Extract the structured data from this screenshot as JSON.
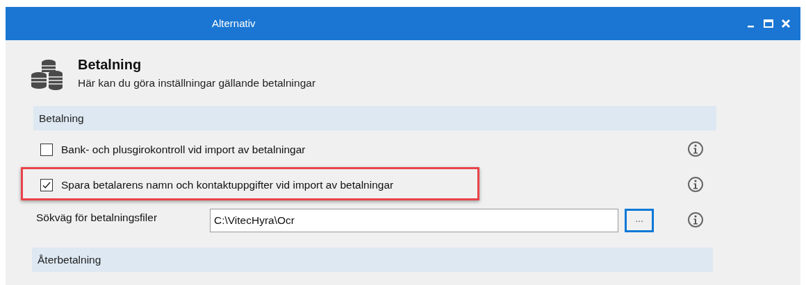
{
  "window": {
    "title": "Alternativ"
  },
  "header": {
    "title": "Betalning",
    "subtitle": "Här kan du göra inställningar gällande betalningar"
  },
  "sections": [
    {
      "title": "Betalning",
      "items": [
        {
          "kind": "checkbox",
          "label": "Bank- och plusgirokontroll vid import av betalningar",
          "checked": false,
          "highlighted": false
        },
        {
          "kind": "checkbox",
          "label": "Spara betalarens namn och kontaktuppgifter vid import av betalningar",
          "checked": true,
          "highlighted": true
        },
        {
          "kind": "path",
          "label": "Sökväg för betalningsfiler",
          "value": "C:\\VitecHyra\\Ocr",
          "button": "...",
          "highlighted": false
        }
      ]
    },
    {
      "title": "Återbetalning"
    }
  ]
}
